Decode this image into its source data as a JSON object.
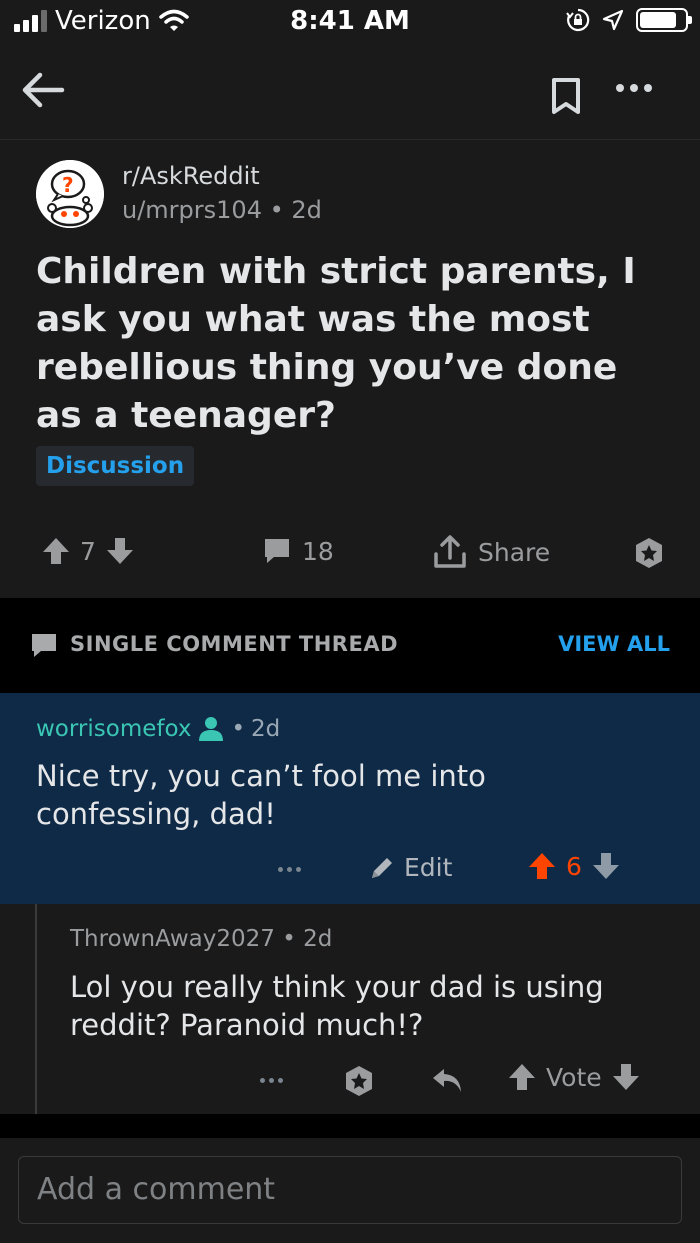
{
  "status_bar": {
    "carrier": "Verizon",
    "time": "8:41 AM"
  },
  "post": {
    "subreddit": "r/AskReddit",
    "author": "u/mrprs104",
    "age": "2d",
    "title": "Children with strict parents, I ask you what was the most rebellious thing you’ve done as a teenager?",
    "flair": "Discussion",
    "score": "7",
    "comment_count": "18",
    "share_label": "Share"
  },
  "thread_bar": {
    "label": "SINGLE COMMENT THREAD",
    "view_all": "VIEW ALL"
  },
  "comment": {
    "author": "worrisomefox",
    "age": "2d",
    "body": "Nice try, you can’t fool me into confessing, dad!",
    "edit_label": "Edit",
    "score": "6"
  },
  "reply": {
    "author": "ThrownAway2027",
    "age": "2d",
    "body": "Lol you really think your dad is using reddit? Paranoid much!?",
    "vote_label": "Vote"
  },
  "composer": {
    "placeholder": "Add a comment"
  },
  "colors": {
    "accent_blue": "#24a0ed",
    "upvote_orange": "#ff4500",
    "op_teal": "#3ac6b3",
    "highlight_bg": "#0e2a47"
  },
  "icons": [
    "back-arrow-icon",
    "bookmark-icon",
    "more-icon",
    "upvote-icon",
    "downvote-icon",
    "comment-icon",
    "share-icon",
    "award-icon",
    "pencil-icon",
    "reply-icon",
    "op-user-icon",
    "wifi-icon",
    "lock-rotation-icon",
    "location-icon",
    "battery-icon"
  ]
}
